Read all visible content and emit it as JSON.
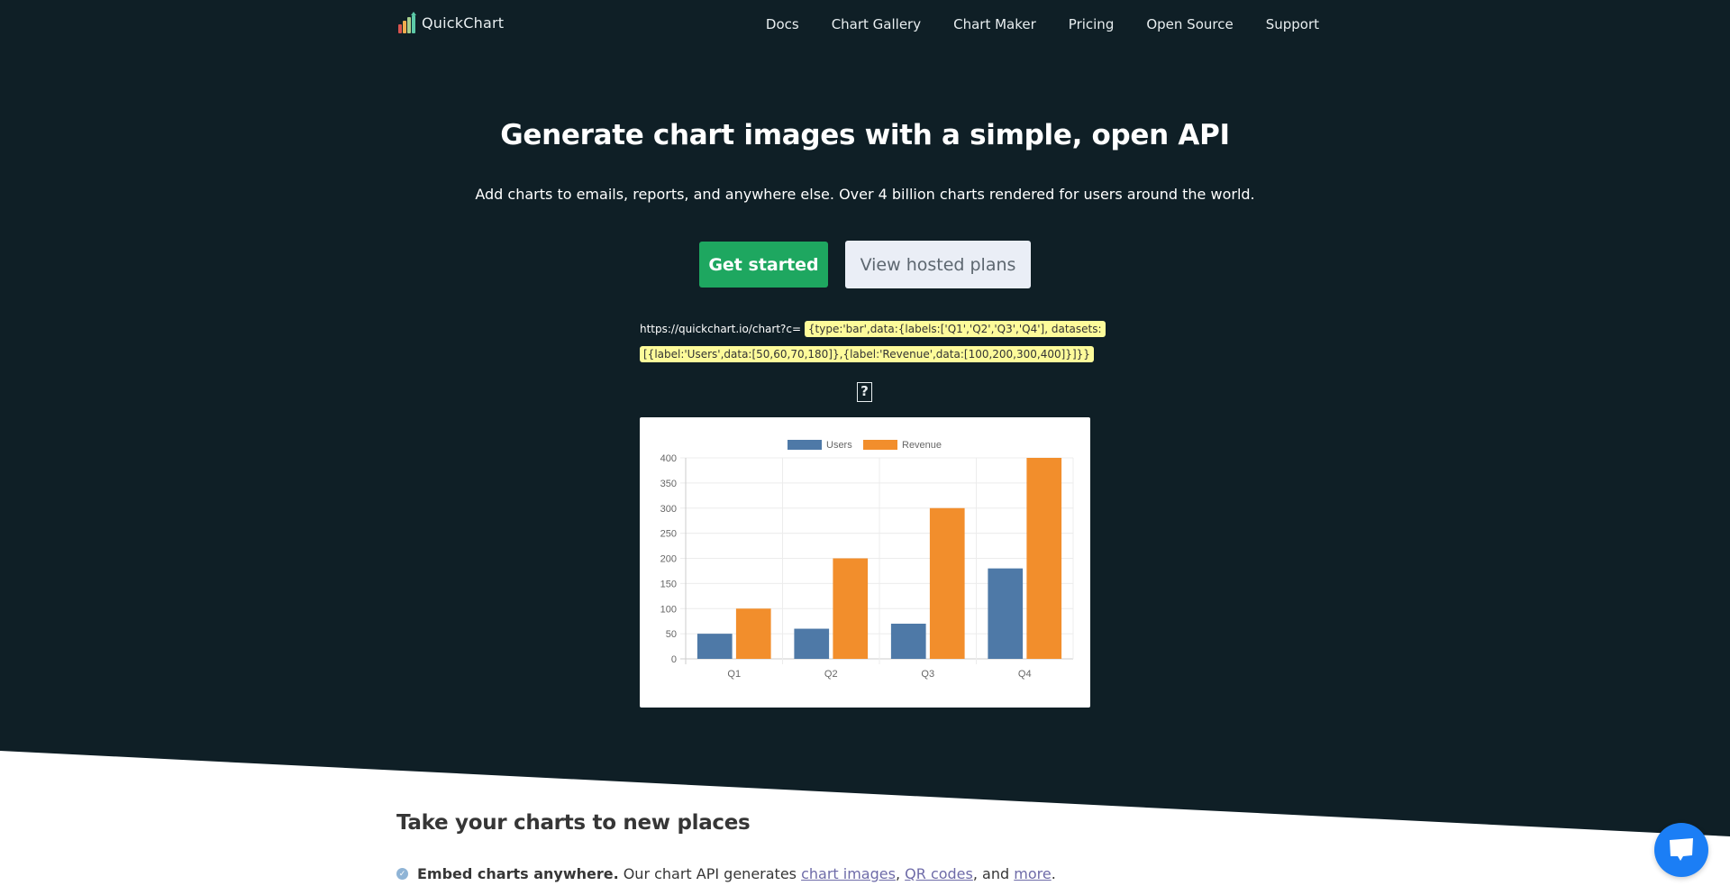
{
  "nav": {
    "logo_text": "QuickChart",
    "links": [
      "Docs",
      "Chart Gallery",
      "Chart Maker",
      "Pricing",
      "Open Source",
      "Support"
    ]
  },
  "hero": {
    "title": "Generate chart images with a simple, open API",
    "subtitle": "Add charts to emails, reports, and anywhere else. Over 4 billion charts rendered for users around the world.",
    "primary_button": "Get started",
    "secondary_button": "View hosted plans",
    "url_prefix": "https://quickchart.io/chart?c=",
    "url_code_line1": "{type:'bar',data:{labels:['Q1','Q2','Q3','Q4'], datasets:",
    "url_code_line2": "[{label:'Users',data:[50,60,70,180]},{label:'Revenue',data:[100,200,300,400]}]}}",
    "broken_image_glyph": "?"
  },
  "colors": {
    "hero_bg": "#0f1f26",
    "primary": "#1ea760",
    "secondary_bg": "#eaeef6",
    "code_highlight": "#fdfb9a",
    "users": "#4e79a7",
    "revenue": "#f28e2c",
    "chat": "#1b7ef5"
  },
  "chart_data": {
    "type": "bar",
    "title": "",
    "categories": [
      "Q1",
      "Q2",
      "Q3",
      "Q4"
    ],
    "series": [
      {
        "name": "Users",
        "values": [
          50,
          60,
          70,
          180
        ],
        "color": "#4e79a7"
      },
      {
        "name": "Revenue",
        "values": [
          100,
          200,
          300,
          400
        ],
        "color": "#f28e2c"
      }
    ],
    "xlabel": "",
    "ylabel": "",
    "ylim": [
      0,
      400
    ],
    "yticks": [
      0,
      50,
      100,
      150,
      200,
      250,
      300,
      350,
      400
    ],
    "grid": true,
    "legend": "top"
  },
  "section": {
    "title": "Take your charts to new places",
    "feature_bold": "Embed charts anywhere.",
    "feature_text": "Our chart API generates",
    "link1": "chart images",
    "sep1": ",",
    "link2": "QR codes",
    "sep2": ", and",
    "link3": "more",
    "end": "."
  }
}
